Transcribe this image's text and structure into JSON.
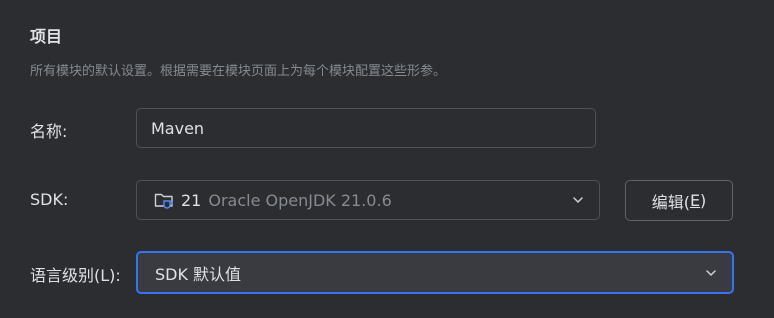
{
  "section": {
    "title": "项目",
    "description": "所有模块的默认设置。根据需要在模块页面上为每个模块配置这些形参。"
  },
  "fields": {
    "name": {
      "label": "名称:",
      "value": "Maven"
    },
    "sdk": {
      "label": "SDK:",
      "version": "21",
      "detail": "Oracle OpenJDK 21.0.6",
      "icon": "folder-coffee-icon",
      "edit_button": {
        "prefix": "编辑(",
        "mnemonic": "E",
        "suffix": ")"
      }
    },
    "language_level": {
      "label": "语言级别(L):",
      "value": "SDK 默认值"
    }
  },
  "colors": {
    "background": "#2b2d30",
    "text": "#dfe1e5",
    "muted_text": "#868a91",
    "border": "#4e5157",
    "focus_border": "#3574f0",
    "focused_fill": "#393b40"
  }
}
